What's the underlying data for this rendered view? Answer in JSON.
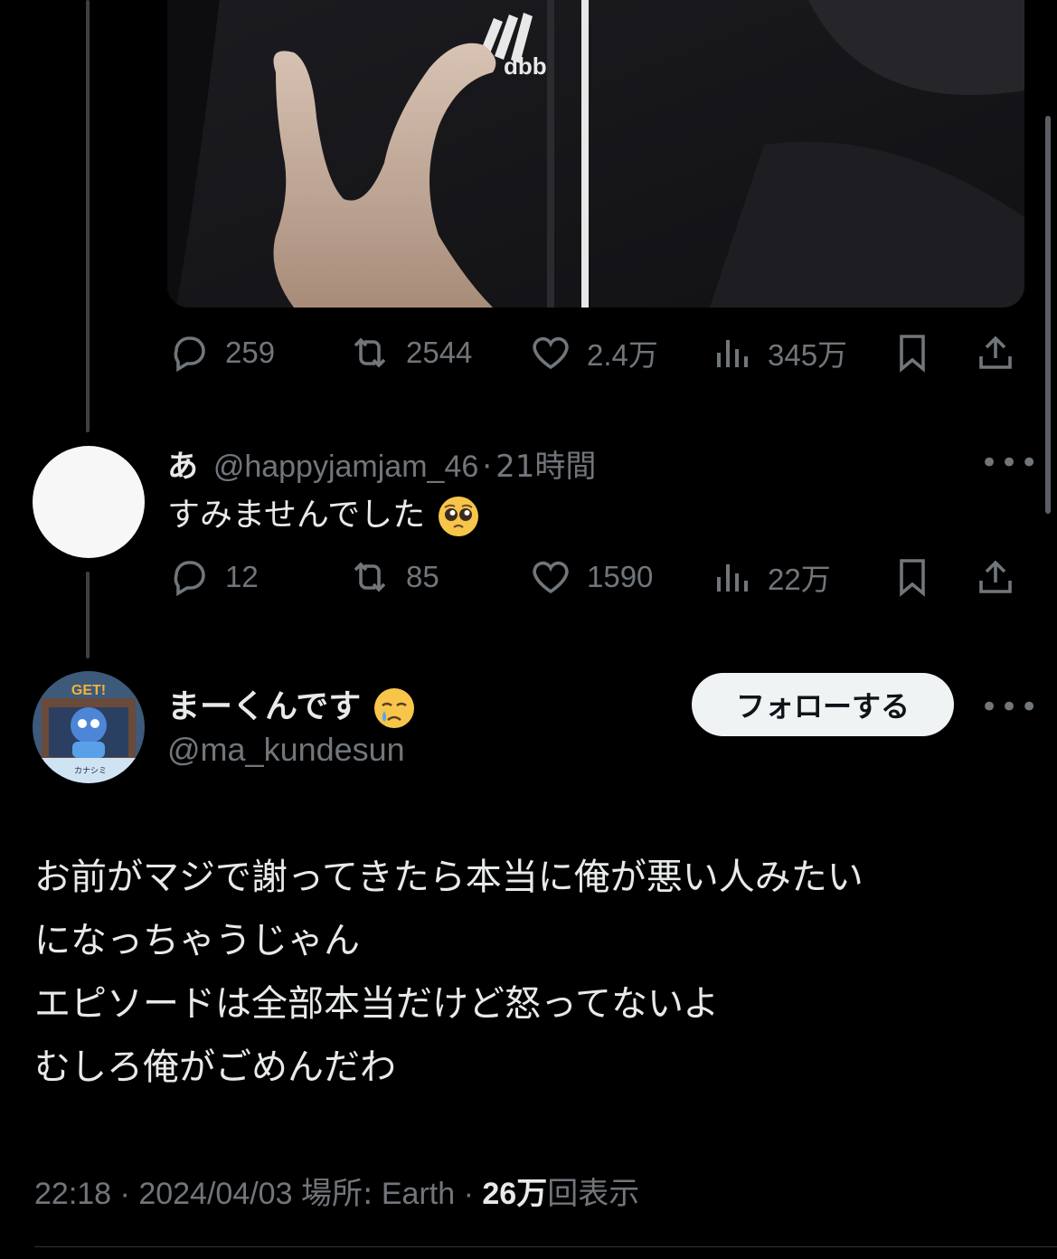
{
  "colors": {
    "background": "#000000",
    "text": "#e7e9ea",
    "muted": "#71767b",
    "line": "#3e4144"
  },
  "tweet1": {
    "actions": {
      "reply": {
        "icon": "reply-icon",
        "count": "259"
      },
      "retweet": {
        "icon": "retweet-icon",
        "count": "2544"
      },
      "like": {
        "icon": "like-icon",
        "count": "2.4万"
      },
      "views": {
        "icon": "views-icon",
        "count": "345万"
      },
      "bookmark": {
        "icon": "bookmark-icon"
      },
      "share": {
        "icon": "share-icon"
      }
    }
  },
  "reply": {
    "name": "あ",
    "handle": "@happyjamjam_46",
    "separator": "·",
    "time": "21時間",
    "text": "すみませんでした",
    "emoji": "pleading-face-emoji",
    "actions": {
      "reply": {
        "count": "12"
      },
      "retweet": {
        "count": "85"
      },
      "like": {
        "count": "1590"
      },
      "views": {
        "count": "22万"
      }
    }
  },
  "main": {
    "name": "まーくんです",
    "name_emoji": "crying-face-emoji",
    "handle": "@ma_kundesun",
    "avatar_badge": "GET!",
    "avatar_caption": "カナシミ",
    "follow_label": "フォローする",
    "body_lines": [
      "お前がマジで謝ってきたら本当に俺が悪い人みたい",
      "になっちゃうじゃん",
      "エピソードは全部本当だけど怒ってないよ",
      "むしろ俺がごめんだわ"
    ],
    "meta": {
      "time": "22:18",
      "sep1": "·",
      "date": "2024/04/03",
      "location_label": "場所:",
      "location": "Earth",
      "sep2": "·",
      "views_count": "26万",
      "views_label": "回表示"
    }
  }
}
